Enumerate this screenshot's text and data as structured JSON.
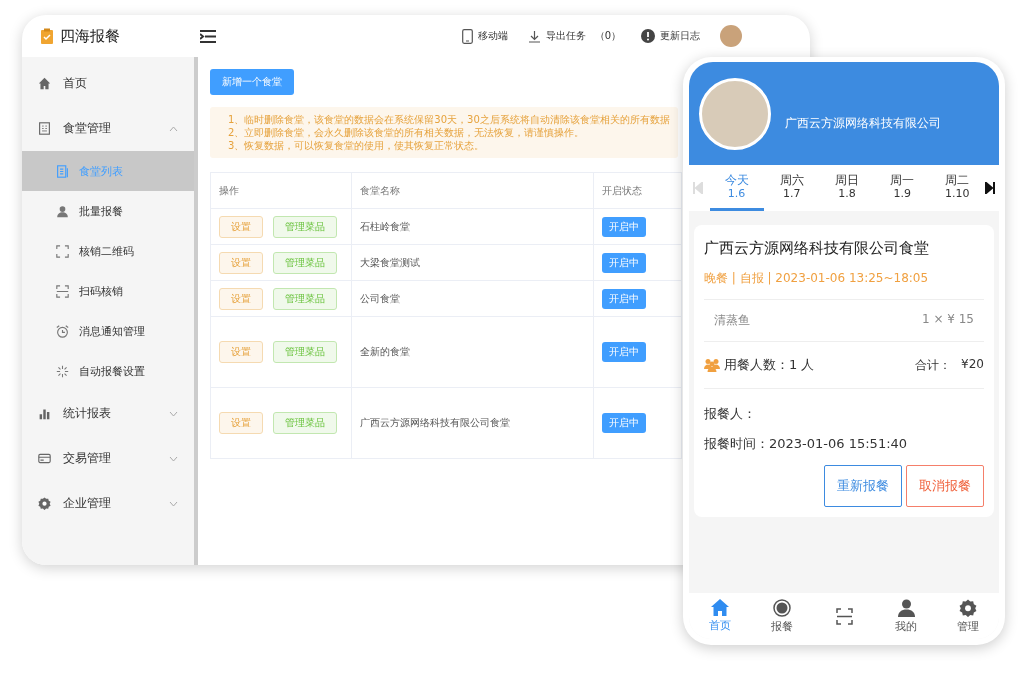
{
  "admin": {
    "logo_text": "四海报餐",
    "header_links": [
      {
        "kind": "phone",
        "label": "移动端"
      },
      {
        "kind": "download",
        "label": "导出任务",
        "count": "（0）"
      },
      {
        "kind": "info",
        "label": "更新日志"
      }
    ],
    "sidebar": {
      "items": [
        {
          "kind": "home",
          "label": "首页"
        },
        {
          "kind": "building",
          "label": "食堂管理",
          "expanded": true,
          "children": [
            {
              "kind": "list",
              "label": "食堂列表",
              "selected": true
            },
            {
              "kind": "user",
              "label": "批量报餐",
              "selected": false
            },
            {
              "kind": "qr",
              "label": "核销二维码",
              "selected": false
            },
            {
              "kind": "scan",
              "label": "扫码核销",
              "selected": false
            },
            {
              "kind": "clock",
              "label": "消息通知管理",
              "selected": false
            },
            {
              "kind": "auto",
              "label": "自动报餐设置",
              "selected": false
            }
          ]
        },
        {
          "kind": "chart",
          "label": "统计报表",
          "expanded": false
        },
        {
          "kind": "card",
          "label": "交易管理",
          "expanded": false
        },
        {
          "kind": "gear",
          "label": "企业管理",
          "expanded": false
        }
      ]
    },
    "add_button": "新增一个食堂",
    "notice": [
      "1、临时删除食堂，该食堂的数据会在系统保留30天，30之后系统将自动清除该食堂相关的所有数据",
      "2、立即删除食堂，会永久删除该食堂的所有相关数据，无法恢复，请谨慎操作。",
      "3、恢复数据，可以恢复食堂的使用，使其恢复正常状态。"
    ],
    "table": {
      "columns": [
        "操作",
        "食堂名称",
        "开启状态"
      ],
      "rows": [
        {
          "actions": [
            "设置",
            "管理菜品"
          ],
          "name": "石柱岭食堂",
          "status": "开启中"
        },
        {
          "actions": [
            "设置",
            "管理菜品"
          ],
          "name": "大梁食堂测试",
          "status": "开启中"
        },
        {
          "actions": [
            "设置",
            "管理菜品"
          ],
          "name": "公司食堂",
          "status": "开启中"
        },
        {
          "actions": [
            "设置",
            "管理菜品"
          ],
          "name": "全新的食堂",
          "status": "开启中"
        },
        {
          "actions": [
            "设置",
            "管理菜品"
          ],
          "name": "广西云方源网络科技有限公司食堂",
          "status": "开启中"
        }
      ]
    }
  },
  "phone": {
    "company": "广西云方源网络科技有限公司",
    "days": [
      {
        "label": "今天",
        "date": "1.6",
        "selected": true
      },
      {
        "label": "周六",
        "date": "1.7",
        "selected": false
      },
      {
        "label": "周日",
        "date": "1.8",
        "selected": false
      },
      {
        "label": "周一",
        "date": "1.9",
        "selected": false
      },
      {
        "label": "周二",
        "date": "1.10",
        "selected": false
      }
    ],
    "prev_disabled": true,
    "order": {
      "title": "广西云方源网络科技有限公司食堂",
      "meta": "晚餐 | 自报 | 2023-01-06  13:25~18:05",
      "dishes": [
        {
          "name": "清蒸鱼",
          "qty": "1 × ¥ 15"
        }
      ],
      "diners": "用餐人数：1 人",
      "total_label": "合计：",
      "total": "¥20",
      "reporter": "报餐人：",
      "time": "报餐时间：2023-01-06 15:51:40",
      "buttons": [
        {
          "kind": "primary",
          "label": "重新报餐"
        },
        {
          "kind": "danger",
          "label": "取消报餐"
        }
      ]
    },
    "tabs": [
      {
        "kind": "home",
        "label": "首页",
        "selected": true
      },
      {
        "kind": "meal",
        "label": "报餐",
        "selected": false
      },
      {
        "kind": "scan",
        "selected": false
      },
      {
        "kind": "user",
        "label": "我的",
        "selected": false
      },
      {
        "kind": "gear",
        "label": "管理",
        "selected": false
      }
    ]
  }
}
